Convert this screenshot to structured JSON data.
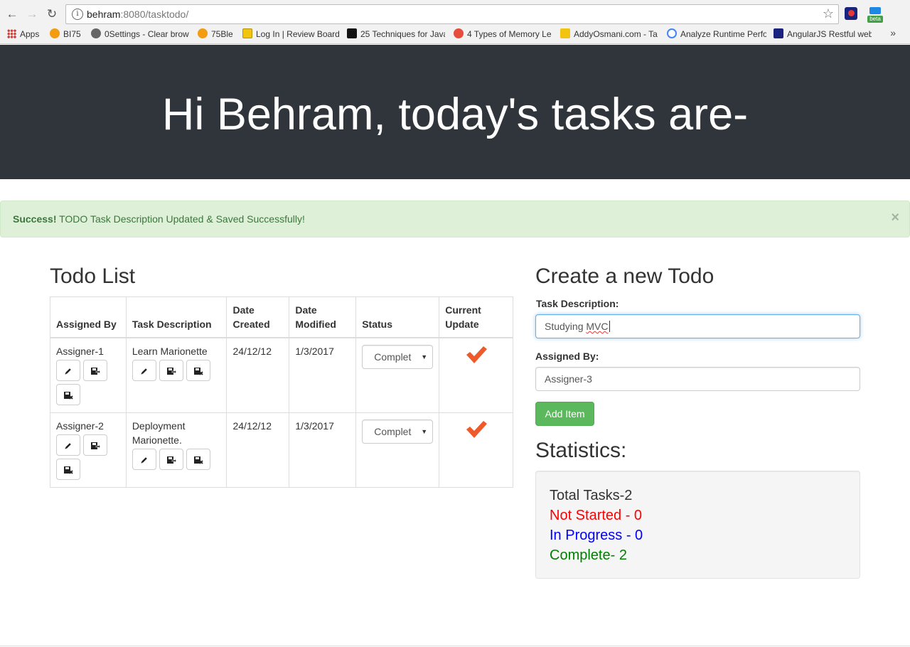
{
  "browser": {
    "url_host": "behram",
    "url_rest": ":8080/tasktodo/",
    "bookmarks": [
      {
        "label": "Apps",
        "icon": "apps-grid-icon"
      },
      {
        "label": "BI75",
        "icon": "sun-icon",
        "color": "#f39c12"
      },
      {
        "label": "0Settings - Clear brow",
        "icon": "gear-icon",
        "color": "#555555"
      },
      {
        "label": "75Ble",
        "icon": "sun-icon",
        "color": "#f39c12"
      },
      {
        "label": "Log In | Review Board",
        "icon": "review-board-icon",
        "color": "#f1c40f"
      },
      {
        "label": "25 Techniques for Java",
        "icon": "d-icon",
        "color": "#111111"
      },
      {
        "label": "4 Types of Memory Le",
        "icon": "star-badge-icon",
        "color": "#e74c3c"
      },
      {
        "label": "AddyOsmani.com - Ta",
        "icon": "avatar-icon",
        "color": "#f1c40f"
      },
      {
        "label": "Analyze Runtime Perfo",
        "icon": "code-icon",
        "color": "#4285f4"
      },
      {
        "label": "AngularJS Restful web",
        "icon": "am-icon",
        "color": "#1a237e"
      }
    ]
  },
  "header": {
    "title": "Hi Behram, today's tasks are-"
  },
  "alert": {
    "strong": "Success!",
    "message": " TODO Task Description Updated & Saved Successfully!",
    "close": "×"
  },
  "todo_list": {
    "title": "Todo List",
    "columns": [
      "Assigned By",
      "Task Description",
      "Date Created",
      "Date Modified",
      "Status",
      "Current Update"
    ],
    "rows": [
      {
        "assigned_by": "Assigner-1",
        "task": "Learn Marionette",
        "created": "24/12/12",
        "modified": "1/3/2017",
        "status": "Complet"
      },
      {
        "assigned_by": "Assigner-2",
        "task": "Deployment Marionette.",
        "created": "24/12/12",
        "modified": "1/3/2017",
        "status": "Complet"
      }
    ],
    "check_color": "#ee5a2b"
  },
  "create_form": {
    "title": "Create a new Todo",
    "desc_label": "Task Description:",
    "desc_value_plain": "Studying ",
    "desc_value_misspelled": "MVC",
    "assigned_label": "Assigned By:",
    "assigned_value": "Assigner-3",
    "add_button": "Add Item"
  },
  "statistics": {
    "title": "Statistics:",
    "total": "Total Tasks-2",
    "not_started": "Not Started - 0",
    "in_progress": "In Progress - 0",
    "complete": "Complete- 2",
    "colors": {
      "not_started": "#ff0000",
      "in_progress": "#0000ff",
      "complete": "#008000"
    }
  }
}
